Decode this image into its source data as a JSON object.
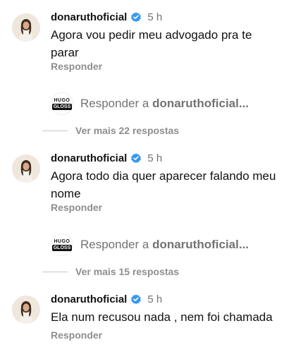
{
  "comments": [
    {
      "username": "donaruthoficial",
      "time": "5 h",
      "text": "Agora vou pedir meu advogado pra te parar",
      "reply_label": "Responder",
      "subreply_prefix": "Responder a ",
      "subreply_target": "donaruthoficial...",
      "subreply_logo_top": "HUGO",
      "subreply_logo_bottom": "GLOSS",
      "more_replies": "Ver mais 22 respostas"
    },
    {
      "username": "donaruthoficial",
      "time": "5 h",
      "text": "Agora todo dia quer aparecer falando meu nome",
      "reply_label": "Responder",
      "subreply_prefix": "Responder a ",
      "subreply_target": "donaruthoficial...",
      "subreply_logo_top": "HUGO",
      "subreply_logo_bottom": "GLOSS",
      "more_replies": "Ver mais 15 respostas"
    },
    {
      "username": "donaruthoficial",
      "time": "5 h",
      "text": "Ela num recusou nada , nem foi chamada",
      "reply_label": "Responder"
    }
  ],
  "colors": {
    "verified": "#3897f0",
    "muted": "#8e8e8e"
  }
}
